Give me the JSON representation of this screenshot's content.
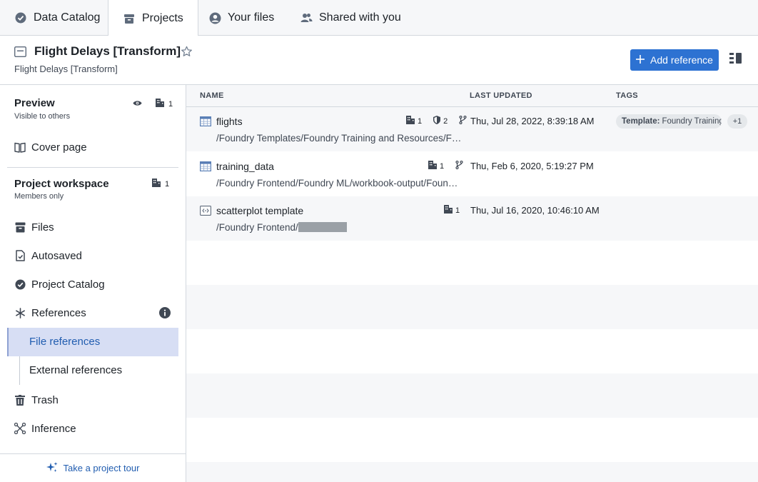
{
  "tabs": [
    {
      "label": "Data Catalog",
      "icon": "check-circle-icon"
    },
    {
      "label": "Projects",
      "icon": "box-icon",
      "active": true
    },
    {
      "label": "Your files",
      "icon": "user-icon"
    },
    {
      "label": "Shared with you",
      "icon": "people-icon"
    }
  ],
  "header": {
    "title": "Flight Delays [Transform]",
    "subtitle": "Flight Delays [Transform]",
    "add_button": "Add reference"
  },
  "sidebar": {
    "preview": {
      "title": "Preview",
      "subtitle": "Visible to others",
      "count": "1"
    },
    "cover_page": "Cover page",
    "workspace": {
      "title": "Project workspace",
      "subtitle": "Members only",
      "count": "1"
    },
    "items": {
      "files": "Files",
      "autosaved": "Autosaved",
      "project_catalog": "Project Catalog",
      "references": "References",
      "file_references": "File references",
      "external_references": "External references",
      "trash": "Trash",
      "inference": "Inference"
    },
    "tour": "Take a project tour"
  },
  "table": {
    "columns": {
      "name": "NAME",
      "updated": "LAST UPDATED",
      "tags": "TAGS"
    },
    "rows": [
      {
        "name": "flights",
        "path": "/Foundry Templates/Foundry Training and Resources/Foundry Training and Resources",
        "orgs": "1",
        "markings": "2",
        "updated": "Thu, Jul 28, 2022, 8:39:18 AM",
        "tag_key": "Template:",
        "tag_value": "Foundry Training and Resources",
        "tag_more": "+1"
      },
      {
        "name": "training_data",
        "path": "/Foundry Frontend/Foundry ML/workbook-output/Foundry ML",
        "orgs": "1",
        "updated": "Thu, Feb 6, 2020, 5:19:27 PM"
      },
      {
        "name": "scatterplot template",
        "path": "/Foundry Frontend/",
        "orgs": "1",
        "updated": "Thu, Jul 16, 2020, 10:46:10 AM"
      }
    ]
  },
  "colors": {
    "accent": "#2d72d2",
    "selected_bg": "#d7def4",
    "link": "#215db0"
  }
}
